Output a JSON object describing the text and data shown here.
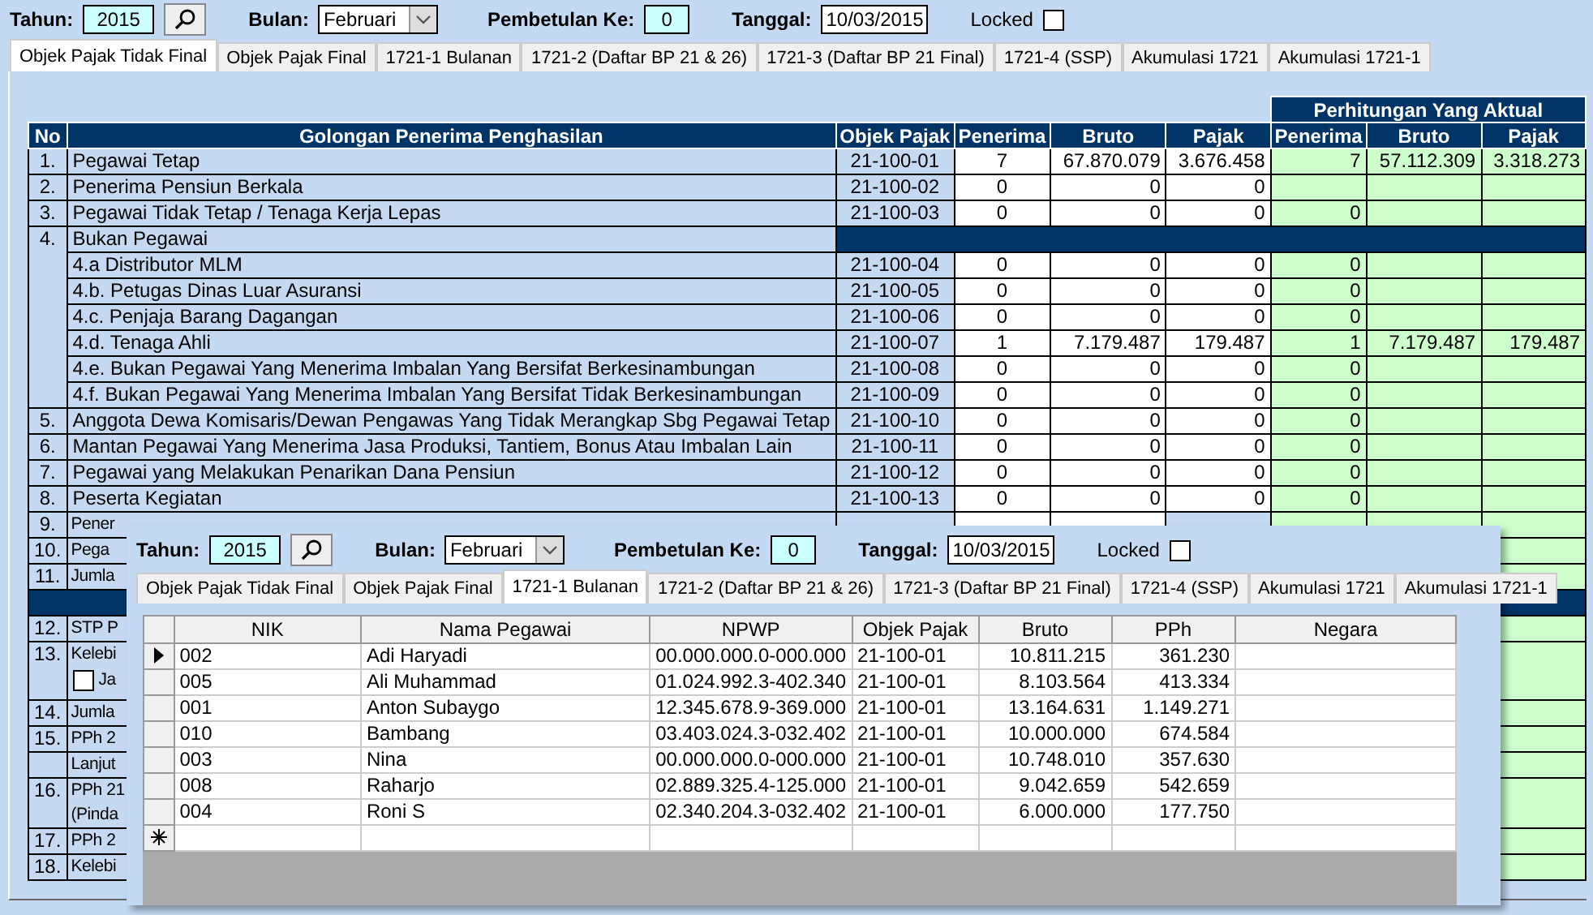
{
  "filter_bar": {
    "year_label": "Tahun:",
    "year": "2015",
    "month_label": "Bulan:",
    "month": "Februari",
    "revision_label": "Pembetulan Ke:",
    "revision": "0",
    "date_label": "Tanggal:",
    "date": "10/03/2015",
    "locked_label": "Locked",
    "locked": false
  },
  "tabs": [
    {
      "label": "Objek Pajak Tidak Final",
      "selected": true
    },
    {
      "label": "Objek Pajak Final",
      "selected": false
    },
    {
      "label": "1721-1 Bulanan",
      "selected": false
    },
    {
      "label": "1721-2 (Daftar BP 21 & 26)",
      "selected": false
    },
    {
      "label": "1721-3 (Daftar BP 21 Final)",
      "selected": false
    },
    {
      "label": "1721-4 (SSP)",
      "selected": false
    },
    {
      "label": "Akumulasi 1721",
      "selected": false
    },
    {
      "label": "Akumulasi 1721-1",
      "selected": false
    }
  ],
  "table": {
    "group_header": "Perhitungan Yang Aktual",
    "columns": [
      "No",
      "Golongan Penerima Penghasilan",
      "Objek Pajak",
      "Penerima",
      "Bruto",
      "Pajak",
      "Penerima",
      "Bruto",
      "Pajak"
    ],
    "rows": [
      {
        "kind": "item",
        "no": "1.",
        "name": "Pegawai Tetap",
        "code": "21-100-01",
        "recipients": "7",
        "gross": "67.870.079",
        "tax": "3.676.458",
        "actual_recipients": "7",
        "actual_gross": "57.112.309",
        "actual_tax": "3.318.273"
      },
      {
        "kind": "item",
        "no": "2.",
        "name": "Penerima Pensiun Berkala",
        "code": "21-100-02",
        "recipients": "0",
        "gross": "0",
        "tax": "0"
      },
      {
        "kind": "item",
        "no": "3.",
        "name": "Pegawai Tidak Tetap / Tenaga Kerja Lepas",
        "code": "21-100-03",
        "recipients": "0",
        "gross": "0",
        "tax": "0",
        "actual_recipients": "0"
      },
      {
        "kind": "group",
        "no": "4.",
        "name": "Bukan Pegawai"
      },
      {
        "kind": "sub",
        "name": "4.a Distributor MLM",
        "code": "21-100-04",
        "recipients": "0",
        "gross": "0",
        "tax": "0",
        "actual_recipients": "0"
      },
      {
        "kind": "sub",
        "name": "4.b. Petugas Dinas Luar Asuransi",
        "code": "21-100-05",
        "recipients": "0",
        "gross": "0",
        "tax": "0",
        "actual_recipients": "0"
      },
      {
        "kind": "sub",
        "name": "4.c. Penjaja Barang Dagangan",
        "code": "21-100-06",
        "recipients": "0",
        "gross": "0",
        "tax": "0",
        "actual_recipients": "0"
      },
      {
        "kind": "sub",
        "name": "4.d. Tenaga Ahli",
        "code": "21-100-07",
        "recipients": "1",
        "gross": "7.179.487",
        "tax": "179.487",
        "actual_recipients": "1",
        "actual_gross": "7.179.487",
        "actual_tax": "179.487"
      },
      {
        "kind": "sub",
        "name": "4.e. Bukan Pegawai Yang Menerima Imbalan Yang Bersifat Berkesinambungan",
        "code": "21-100-08",
        "recipients": "0",
        "gross": "0",
        "tax": "0",
        "actual_recipients": "0"
      },
      {
        "kind": "sub",
        "name": "4.f. Bukan Pegawai Yang Menerima Imbalan Yang Bersifat Tidak Berkesinambungan",
        "code": "21-100-09",
        "recipients": "0",
        "gross": "0",
        "tax": "0",
        "actual_recipients": "0"
      },
      {
        "kind": "item",
        "no": "5.",
        "name": "Anggota Dewa Komisaris/Dewan Pengawas Yang Tidak Merangkap Sbg Pegawai Tetap",
        "code": "21-100-10",
        "recipients": "0",
        "gross": "0",
        "tax": "0",
        "actual_recipients": "0"
      },
      {
        "kind": "item",
        "no": "6.",
        "name": "Mantan Pegawai Yang Menerima Jasa Produksi, Tantiem, Bonus Atau Imbalan Lain",
        "code": "21-100-11",
        "recipients": "0",
        "gross": "0",
        "tax": "0",
        "actual_recipients": "0"
      },
      {
        "kind": "item",
        "no": "7.",
        "name": "Pegawai yang Melakukan Penarikan Dana Pensiun",
        "code": "21-100-12",
        "recipients": "0",
        "gross": "0",
        "tax": "0",
        "actual_recipients": "0"
      },
      {
        "kind": "item",
        "no": "8.",
        "name": "Peserta Kegiatan",
        "code": "21-100-13",
        "recipients": "0",
        "gross": "0",
        "tax": "0",
        "actual_recipients": "0"
      },
      {
        "kind": "covered",
        "no": "9.",
        "name": "Pener"
      },
      {
        "kind": "covered",
        "no": "10.",
        "name": "Pega"
      },
      {
        "kind": "covered",
        "no": "11.",
        "name": "Jumla"
      },
      {
        "kind": "band"
      },
      {
        "kind": "covered",
        "no": "12.",
        "name": "STP P"
      },
      {
        "kind": "covered",
        "no": "13.",
        "name": "Kelebi",
        "option": {
          "label": "Ja",
          "checked": false
        }
      },
      {
        "kind": "covered",
        "no": "14.",
        "name": "Jumla"
      },
      {
        "kind": "covered",
        "no": "15.",
        "name": "PPh 2"
      },
      {
        "kind": "covered",
        "name": "Lanjut"
      },
      {
        "kind": "covered",
        "no": "16.",
        "name": "PPh 21",
        "name_line_2": "(Pinda"
      },
      {
        "kind": "covered",
        "no": "17.",
        "name": "PPh 2"
      },
      {
        "kind": "covered",
        "no": "18.",
        "name": "Kelebi"
      }
    ]
  },
  "overlay": {
    "filter_bar": {
      "year_label": "Tahun:",
      "year": "2015",
      "month_label": "Bulan:",
      "month": "Februari",
      "revision_label": "Pembetulan Ke:",
      "revision": "0",
      "date_label": "Tanggal:",
      "date": "10/03/2015",
      "locked_label": "Locked",
      "locked": false
    },
    "tabs": [
      {
        "label": "Objek Pajak Tidak Final",
        "selected": false
      },
      {
        "label": "Objek Pajak Final",
        "selected": false
      },
      {
        "label": "1721-1 Bulanan",
        "selected": true
      },
      {
        "label": "1721-2 (Daftar BP 21 & 26)",
        "selected": false
      },
      {
        "label": "1721-3 (Daftar BP 21 Final)",
        "selected": false
      },
      {
        "label": "1721-4 (SSP)",
        "selected": false
      },
      {
        "label": "Akumulasi 1721",
        "selected": false
      },
      {
        "label": "Akumulasi 1721-1",
        "selected": false
      }
    ],
    "grid": {
      "columns": [
        "NIK",
        "Nama Pegawai",
        "NPWP",
        "Objek Pajak",
        "Bruto",
        "PPh",
        "Negara"
      ],
      "rows": [
        {
          "current": true,
          "nik": "002",
          "name": "Adi Haryadi",
          "npwp": "00.000.000.0-000.000",
          "code": "21-100-01",
          "gross": "10.811.215",
          "tax": "361.230"
        },
        {
          "current": false,
          "nik": "005",
          "name": "Ali Muhammad",
          "npwp": "01.024.992.3-402.340",
          "code": "21-100-01",
          "gross": "8.103.564",
          "tax": "413.334"
        },
        {
          "current": false,
          "nik": "001",
          "name": "Anton Subaygo",
          "npwp": "12.345.678.9-369.000",
          "code": "21-100-01",
          "gross": "13.164.631",
          "tax": "1.149.271"
        },
        {
          "current": false,
          "nik": "010",
          "name": "Bambang",
          "npwp": "03.403.024.3-032.402",
          "code": "21-100-01",
          "gross": "10.000.000",
          "tax": "674.584"
        },
        {
          "current": false,
          "nik": "003",
          "name": "Nina",
          "npwp": "00.000.000.0-000.000",
          "code": "21-100-01",
          "gross": "10.748.010",
          "tax": "357.630"
        },
        {
          "current": false,
          "nik": "008",
          "name": "Raharjo",
          "npwp": "02.889.325.4-125.000",
          "code": "21-100-01",
          "gross": "9.042.659",
          "tax": "542.659"
        },
        {
          "current": false,
          "nik": "004",
          "name": "Roni S",
          "npwp": "02.340.204.3-032.402",
          "code": "21-100-01",
          "gross": "6.000.000",
          "tax": "177.750"
        }
      ]
    }
  }
}
